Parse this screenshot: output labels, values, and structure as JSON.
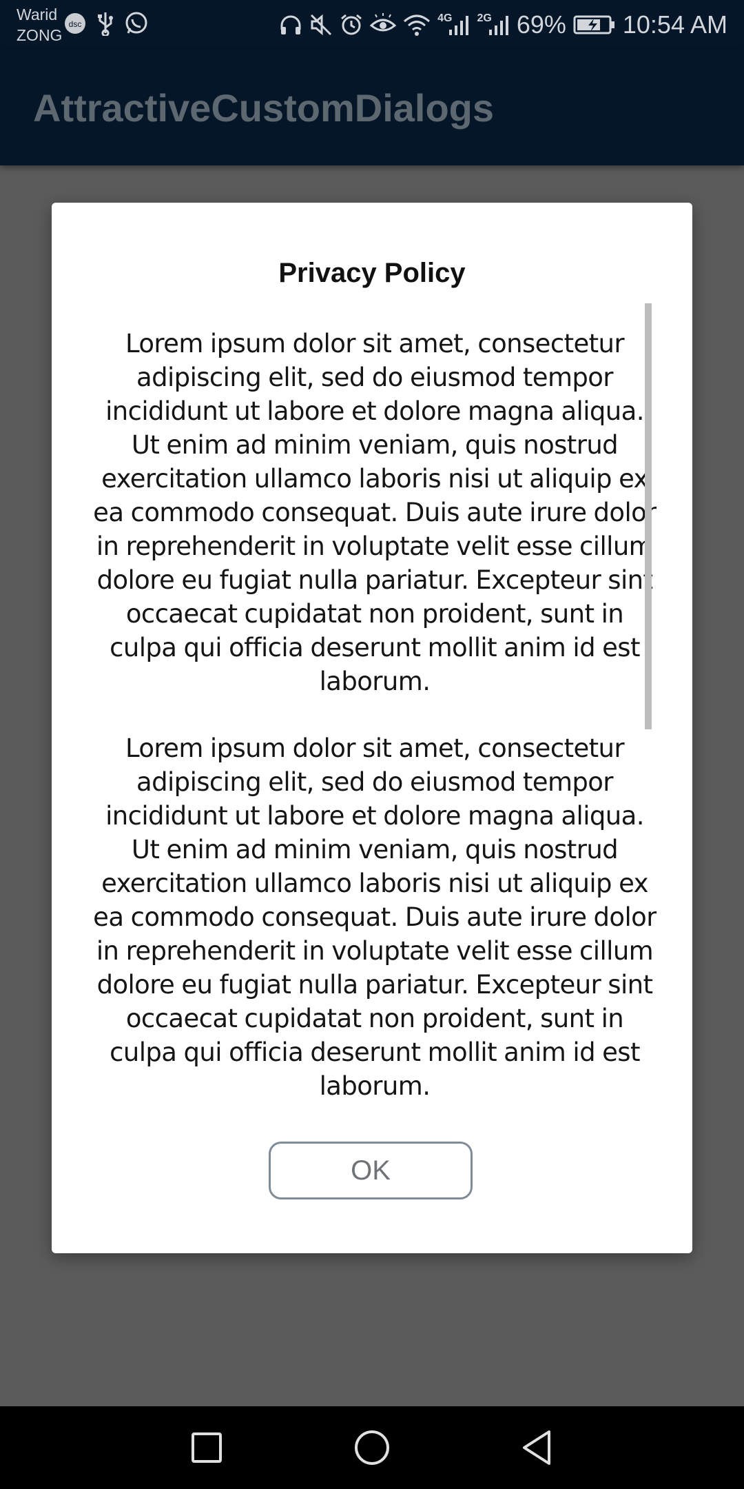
{
  "status_bar": {
    "carrier_line1": "Warid",
    "carrier_line2": "ZONG",
    "network_4g": "4G",
    "network_2g": "2G",
    "battery_percent": "69%",
    "time": "10:54 AM",
    "left_icons": [
      "cast-icon",
      "usb-icon",
      "whatsapp-icon"
    ],
    "right_icons": [
      "headphones-icon",
      "mute-icon",
      "alarm-icon",
      "eye-icon",
      "wifi-icon",
      "signal-icon",
      "signal-icon",
      "battery-charging-icon"
    ]
  },
  "app_bar": {
    "title": "AttractiveCustomDialogs"
  },
  "dialog": {
    "title": "Privacy Policy",
    "paragraphs": [
      "Lorem ipsum dolor sit amet, consectetur adipiscing elit, sed do eiusmod tempor incididunt ut labore et dolore magna aliqua. Ut enim ad minim veniam, quis nostrud exercitation ullamco laboris nisi ut aliquip ex ea commodo consequat. Duis aute irure dolor in reprehenderit in voluptate velit esse cillum dolore eu fugiat nulla pariatur. Excepteur sint occaecat cupidatat non proident, sunt in culpa qui officia deserunt mollit anim id est laborum.",
      "Lorem ipsum dolor sit amet, consectetur adipiscing elit, sed do eiusmod tempor incididunt ut labore et dolore magna aliqua. Ut enim ad minim veniam, quis nostrud exercitation ullamco laboris nisi ut aliquip ex ea commodo consequat. Duis aute irure dolor in reprehenderit in voluptate velit esse cillum dolore eu fugiat nulla pariatur. Excepteur sint occaecat cupidatat non proident, sunt in culpa qui officia deserunt mollit anim id est laborum."
    ],
    "ok_label": "OK"
  },
  "nav_bar": {
    "buttons": [
      "recents-square-icon",
      "home-circle-icon",
      "back-triangle-icon"
    ]
  },
  "colors": {
    "app_bar": "#051628",
    "scrim": "#5b5b5b",
    "dialog_bg": "#ffffff",
    "ok_border": "#7f8c97",
    "title_text": "#5d6770"
  }
}
